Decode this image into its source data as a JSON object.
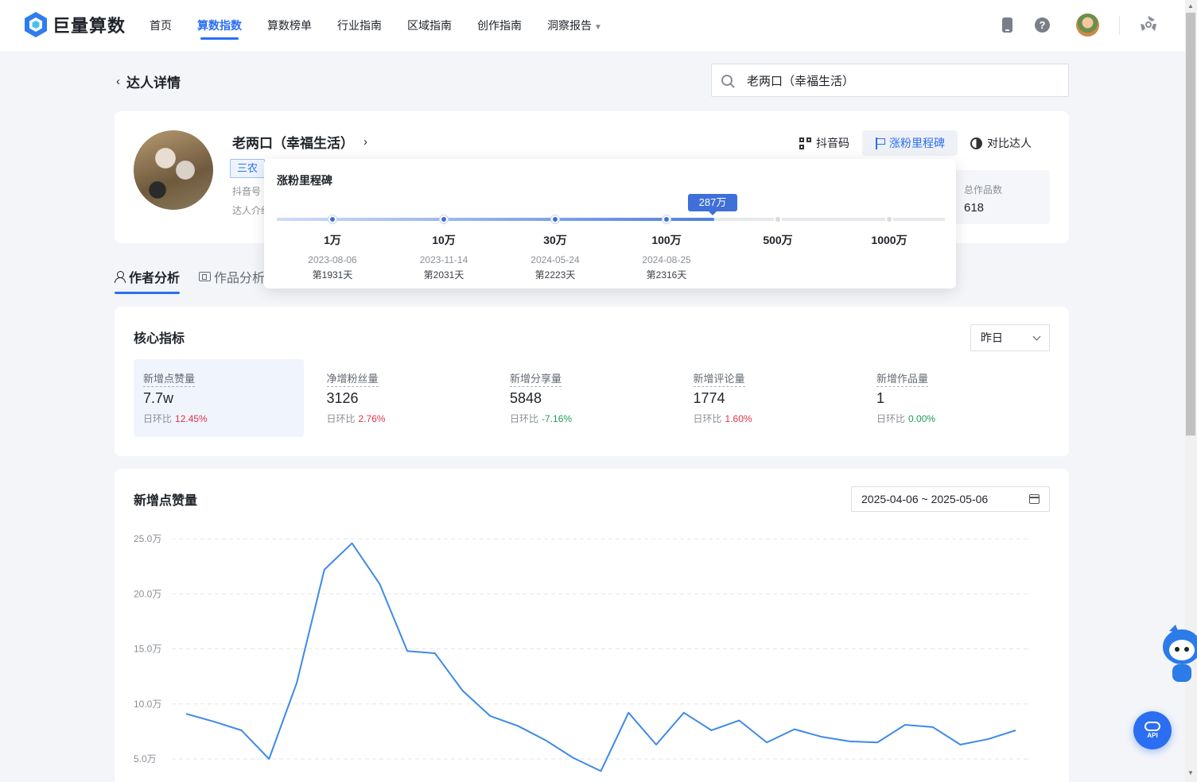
{
  "brand": {
    "name": "巨量算数"
  },
  "nav": {
    "items": [
      {
        "label": "首页",
        "active": false
      },
      {
        "label": "算数指数",
        "active": true
      },
      {
        "label": "算数榜单",
        "active": false
      },
      {
        "label": "行业指南",
        "active": false
      },
      {
        "label": "区域指南",
        "active": false
      },
      {
        "label": "创作指南",
        "active": false
      },
      {
        "label": "洞察报告",
        "active": false,
        "caret": "▼"
      }
    ]
  },
  "header": {
    "back_label": "达人详情",
    "search_value": "老两口（幸福生活）"
  },
  "profile": {
    "name": "老两口（幸福生活）",
    "tag": "三农",
    "meta_douyin": "抖音号",
    "meta_intro": "达人介绍",
    "actions": {
      "qr": "抖音码",
      "milestone": "涨粉里程碑",
      "compare": "对比达人"
    },
    "total_works_label": "总作品数",
    "total_works_value": "618"
  },
  "milestone": {
    "title": "涨粉里程碑",
    "current": "287万",
    "current_fraction": 0.655,
    "points": [
      {
        "value": "1万",
        "date": "2023-08-06",
        "day": "第1931天",
        "reached": true
      },
      {
        "value": "10万",
        "date": "2023-11-14",
        "day": "第2031天",
        "reached": true
      },
      {
        "value": "30万",
        "date": "2024-05-24",
        "day": "第2223天",
        "reached": true
      },
      {
        "value": "100万",
        "date": "2024-08-25",
        "day": "第2316天",
        "reached": true
      },
      {
        "value": "500万",
        "date": "",
        "day": "",
        "reached": false
      },
      {
        "value": "1000万",
        "date": "",
        "day": "",
        "reached": false
      }
    ]
  },
  "tabs": [
    {
      "label": "作者分析",
      "active": true,
      "icon": "person-icon"
    },
    {
      "label": "作品分析",
      "active": false,
      "icon": "film-icon"
    }
  ],
  "core": {
    "title": "核心指标",
    "period": "昨日",
    "change_label": "日环比",
    "metrics": [
      {
        "label": "新增点赞量",
        "value": "7.7w",
        "change": "12.45%",
        "dir": "up",
        "active": true
      },
      {
        "label": "净增粉丝量",
        "value": "3126",
        "change": "2.76%",
        "dir": "up",
        "active": false
      },
      {
        "label": "新增分享量",
        "value": "5848",
        "change": "-7.16%",
        "dir": "down",
        "active": false
      },
      {
        "label": "新增评论量",
        "value": "1774",
        "change": "1.60%",
        "dir": "up",
        "active": false
      },
      {
        "label": "新增作品量",
        "value": "1",
        "change": "0.00%",
        "dir": "down",
        "active": false
      }
    ]
  },
  "chart": {
    "title": "新增点赞量",
    "date_range": "2025-04-06 ~ 2025-05-06"
  },
  "chart_data": {
    "type": "line",
    "title": "新增点赞量",
    "y_unit": "万",
    "yticks": [
      "25.0万",
      "20.0万",
      "15.0万",
      "10.0万",
      "5.0万"
    ],
    "ytick_values": [
      25,
      20,
      15,
      10,
      5
    ],
    "ylim": [
      5,
      25
    ],
    "grid": true,
    "line_color": "#3d8ae6",
    "values": [
      9.1,
      8.4,
      7.6,
      5.0,
      11.9,
      22.2,
      24.6,
      20.9,
      14.8,
      14.6,
      11.2,
      8.9,
      8.0,
      6.7,
      5.1,
      3.9,
      9.2,
      6.3,
      9.2,
      7.6,
      8.5,
      6.5,
      7.7,
      7.0,
      6.6,
      6.5,
      8.1,
      7.9,
      6.3,
      6.8,
      7.6
    ]
  },
  "api": {
    "label": "API"
  }
}
